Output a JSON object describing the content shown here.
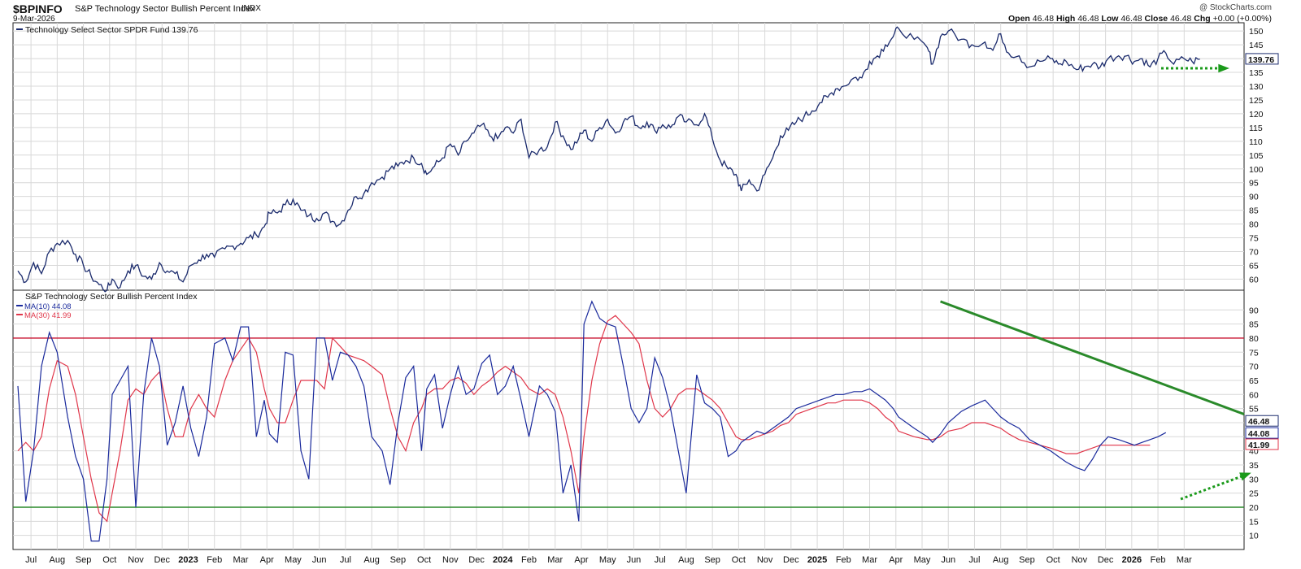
{
  "header": {
    "ticker": "$BPINFO",
    "index_name": "S&P Technology Sector Bullish Percent Index",
    "index_type": "INDX",
    "date": "9-Mar-2026",
    "credit": "@ StockCharts.com",
    "open_label": "Open",
    "open": "46.48",
    "high_label": "High",
    "high": "46.48",
    "low_label": "Low",
    "low": "46.48",
    "close_label": "Close",
    "close": "46.48",
    "chg_label": "Chg",
    "chg": "+0.00 (+0.00%)"
  },
  "colors": {
    "price_line": "#1a2a6c",
    "bpi_line": "#1a2a9c",
    "ma30": "#e0364a",
    "threshold_high": "#c8102e",
    "threshold_low": "#2a8a2a",
    "trendline": "#2a8a2a",
    "arrow": "#1a9a1a",
    "grid": "#d8d8d8"
  },
  "chart_data": [
    {
      "type": "line",
      "legend": "Technology Select Sector SPDR Fund 139.76",
      "last_value": "139.76",
      "ylim": [
        56,
        153
      ],
      "yticks": [
        60,
        65,
        70,
        75,
        80,
        85,
        90,
        95,
        100,
        105,
        110,
        115,
        120,
        125,
        130,
        135,
        140,
        145,
        150
      ],
      "x": [
        0,
        0.3,
        0.6,
        0.9,
        1.2,
        1.5,
        1.9,
        2.2,
        2.5,
        2.8,
        3.1,
        3.4,
        3.6,
        3.9,
        4.2,
        4.5,
        4.8,
        5.1,
        5.4,
        5.7,
        6,
        6.3,
        6.6,
        6.9,
        7.2,
        7.5,
        7.9,
        8.2,
        8.5,
        8.8,
        9.1,
        9.4,
        9.6,
        9.9,
        10.2,
        10.5,
        10.8,
        11.1,
        11.4,
        11.7,
        12,
        12.3,
        12.6,
        12.9,
        13.2,
        13.5,
        13.9,
        14.2,
        14.5,
        14.8,
        15.1,
        15.4,
        15.6,
        15.9,
        16.2,
        16.5,
        16.8,
        17.1,
        17.4,
        17.7,
        18,
        18.3,
        18.6,
        18.9,
        19.2,
        19.5,
        19.9,
        20.2,
        20.5,
        20.8,
        21.1,
        21.4,
        21.6,
        21.9,
        22.2,
        22.5,
        22.8,
        23.1,
        23.4,
        23.7,
        24,
        24.3,
        24.6,
        24.9,
        25.2,
        25.5,
        25.9,
        26.2,
        26.5,
        26.8,
        27.1,
        27.4,
        27.6,
        27.9,
        28.2,
        28.5,
        28.8,
        29.1,
        29.4,
        29.7,
        30,
        30.3,
        30.6,
        30.9,
        31.2,
        31.5,
        31.9,
        32.2,
        32.5,
        32.8,
        33.1,
        33.4,
        33.6,
        34.2,
        34.7,
        34.9,
        35.2,
        35.5,
        36,
        36.4,
        36.9,
        37.2,
        37.5,
        37.8,
        38.2,
        38.6,
        39,
        39.4,
        39.7,
        40,
        40.4,
        40.7,
        41,
        41.3,
        41.6,
        42,
        42.3,
        42.6,
        42.9,
        43.2,
        43.5,
        43.8,
        44.1,
        44.5,
        44.8,
        45.1,
        45.4,
        45.7
      ],
      "values": [
        63,
        59,
        66,
        62,
        70,
        73,
        74,
        69,
        65,
        61,
        58,
        56,
        60,
        57,
        63,
        65,
        61,
        60,
        66,
        63,
        62,
        59,
        65,
        67,
        69,
        68,
        71,
        72,
        73,
        75,
        76,
        79,
        84,
        84,
        87,
        89,
        85,
        83,
        82,
        84,
        81,
        80,
        85,
        90,
        91,
        95,
        97,
        100,
        101,
        103,
        104,
        102,
        98,
        101,
        104,
        109,
        105,
        110,
        113,
        116,
        112,
        111,
        115,
        113,
        118,
        104,
        107,
        108,
        117,
        112,
        107,
        111,
        114,
        110,
        115,
        118,
        113,
        117,
        119,
        115,
        117,
        114,
        116,
        115,
        119,
        117,
        116,
        120,
        111,
        103,
        100,
        98,
        92,
        96,
        92,
        98,
        104,
        112,
        114,
        117,
        119,
        121,
        124,
        126,
        129,
        130,
        133,
        133,
        139,
        141,
        145,
        148,
        151,
        147,
        144,
        138,
        148,
        150,
        147,
        145,
        146,
        143,
        149,
        142,
        141,
        137,
        139,
        140,
        138,
        139,
        136,
        137,
        138,
        137,
        140,
        141,
        141,
        139,
        140,
        137,
        140,
        142,
        138,
        140,
        139,
        139.76
      ]
    },
    {
      "type": "line",
      "title": "S&P Technology Sector Bullish Percent Index",
      "last_value": "46.48",
      "ylim": [
        5,
        97
      ],
      "yticks": [
        10,
        15,
        20,
        25,
        30,
        35,
        40,
        45,
        50,
        55,
        60,
        65,
        70,
        75,
        80,
        85,
        90
      ],
      "hlines": [
        80,
        20
      ],
      "x": [
        0,
        0.3,
        0.6,
        0.9,
        1.2,
        1.5,
        1.9,
        2.2,
        2.5,
        2.8,
        3.1,
        3.4,
        3.6,
        3.9,
        4.2,
        4.5,
        4.8,
        5.1,
        5.4,
        5.7,
        6,
        6.3,
        6.6,
        6.9,
        7.2,
        7.5,
        7.9,
        8.2,
        8.5,
        8.8,
        9.1,
        9.4,
        9.6,
        9.9,
        10.2,
        10.5,
        10.8,
        11.1,
        11.4,
        11.7,
        12,
        12.3,
        12.6,
        12.9,
        13.2,
        13.5,
        13.9,
        14.2,
        14.5,
        14.8,
        15.1,
        15.4,
        15.6,
        15.9,
        16.2,
        16.5,
        16.8,
        17.1,
        17.4,
        17.7,
        18,
        18.3,
        18.6,
        18.9,
        19.2,
        19.5,
        19.9,
        20.2,
        20.5,
        20.8,
        21.1,
        21.4,
        21.6,
        21.9,
        22.2,
        22.5,
        22.8,
        23.1,
        23.4,
        23.7,
        24,
        24.3,
        24.6,
        24.9,
        25.2,
        25.5,
        25.9,
        26.2,
        26.5,
        26.8,
        27.1,
        27.4,
        27.6,
        27.9,
        28.2,
        28.5,
        28.8,
        29.1,
        29.4,
        29.7,
        30,
        30.3,
        30.6,
        30.9,
        31.2,
        31.5,
        31.9,
        32.2,
        32.5,
        32.8,
        33.1,
        33.4,
        33.6,
        34.2,
        34.7,
        34.9,
        35.2,
        35.5,
        36,
        36.4,
        36.9,
        37.2,
        37.5,
        37.8,
        38.2,
        38.6,
        39,
        39.4,
        39.7,
        40,
        40.4,
        40.7,
        41,
        41.3,
        41.6,
        42,
        42.3,
        42.6,
        42.9,
        43.2,
        43.5,
        43.8,
        44.1,
        44.5,
        44.8,
        45.1,
        45.4,
        45.7
      ],
      "values": [
        63,
        22,
        40,
        70,
        82,
        75,
        52,
        38,
        30,
        8,
        8,
        30,
        60,
        65,
        70,
        20,
        60,
        80,
        70,
        42,
        50,
        63,
        48,
        38,
        52,
        78,
        80,
        72,
        84,
        84,
        45,
        58,
        46,
        43,
        75,
        74,
        40,
        30,
        80,
        80,
        65,
        75,
        74,
        70,
        63,
        45,
        40,
        28,
        50,
        66,
        70,
        40,
        62,
        67,
        48,
        60,
        70,
        60,
        62,
        71,
        74,
        60,
        63,
        70,
        58,
        45,
        63,
        60,
        54,
        25,
        35,
        15,
        85,
        93,
        87,
        85,
        84,
        70,
        55,
        50,
        55,
        73,
        66,
        55,
        40,
        25,
        67,
        57,
        55,
        52,
        38,
        40,
        43,
        45,
        47,
        46,
        48,
        50,
        52,
        55,
        56,
        57,
        58,
        59,
        60,
        60,
        61,
        61,
        62,
        60,
        58,
        55,
        52,
        48,
        45,
        43,
        46,
        50,
        54,
        56,
        58,
        55,
        52,
        50,
        48,
        44,
        42,
        40,
        38,
        36,
        34,
        33,
        37,
        42,
        45,
        44,
        43,
        42,
        43,
        44,
        45,
        46.48
      ],
      "series": [
        {
          "name": "MA(10)",
          "value": "44.08"
        },
        {
          "name": "MA(30)",
          "value": "41.99"
        }
      ]
    }
  ],
  "ma30": {
    "values": [
      40,
      43,
      40,
      45,
      62,
      72,
      70,
      60,
      45,
      30,
      18,
      15,
      25,
      40,
      58,
      62,
      60,
      65,
      68,
      55,
      45,
      45,
      55,
      60,
      55,
      52,
      65,
      72,
      76,
      80,
      75,
      62,
      55,
      50,
      50,
      58,
      65,
      65,
      65,
      62,
      80,
      77,
      74,
      73,
      72,
      70,
      67,
      55,
      45,
      40,
      50,
      55,
      60,
      62,
      62,
      65,
      66,
      64,
      60,
      63,
      65,
      68,
      70,
      68,
      66,
      62,
      60,
      62,
      60,
      52,
      40,
      25,
      45,
      65,
      78,
      86,
      88,
      85,
      82,
      78,
      65,
      55,
      52,
      55,
      60,
      62,
      62,
      60,
      58,
      55,
      50,
      45,
      44,
      44,
      45,
      46,
      47,
      49,
      50,
      53,
      54,
      55,
      56,
      57,
      57,
      58,
      58,
      58,
      57,
      55,
      52,
      50,
      47,
      45,
      44,
      44,
      45,
      47,
      48,
      50,
      50,
      49,
      48,
      46,
      44,
      43,
      42,
      41,
      40,
      39,
      39,
      40,
      41,
      42,
      42,
      42,
      42,
      42,
      42,
      41.99
    ]
  },
  "x_axis": {
    "labels": [
      "Jul",
      "Aug",
      "Sep",
      "Oct",
      "Nov",
      "Dec",
      "2023",
      "Feb",
      "Mar",
      "Apr",
      "May",
      "Jun",
      "Jul",
      "Aug",
      "Sep",
      "Oct",
      "Nov",
      "Dec",
      "2024",
      "Feb",
      "Mar",
      "Apr",
      "May",
      "Jun",
      "Jul",
      "Aug",
      "Sep",
      "Oct",
      "Nov",
      "Dec",
      "2025",
      "Feb",
      "Mar",
      "Apr",
      "May",
      "Jun",
      "Jul",
      "Aug",
      "Sep",
      "Oct",
      "Nov",
      "Dec",
      "2026",
      "Feb",
      "Mar"
    ]
  }
}
